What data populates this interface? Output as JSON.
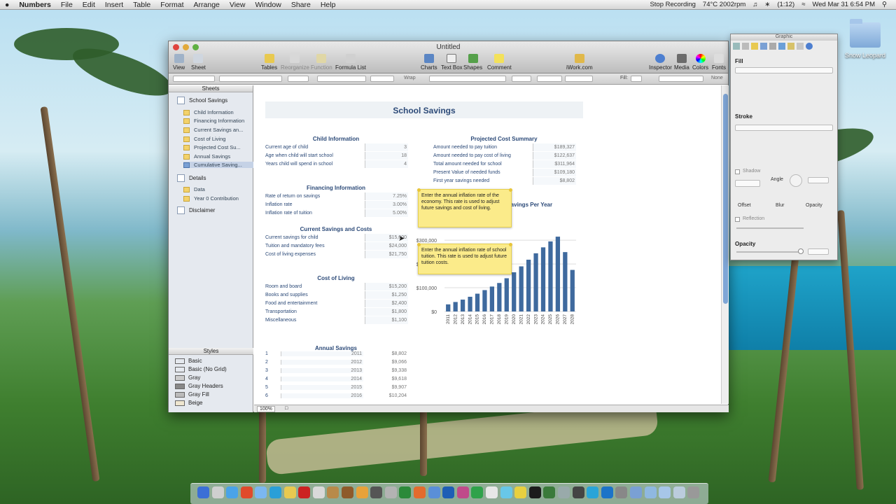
{
  "menubar": {
    "apple": "",
    "app": "Numbers",
    "items": [
      "File",
      "Edit",
      "Insert",
      "Table",
      "Format",
      "Arrange",
      "View",
      "Window",
      "Share",
      "Help"
    ],
    "status": [
      "Stop Recording",
      "74°C 2002rpm",
      "(1:12)",
      "Wed Mar 31  6:54 PM"
    ]
  },
  "desktop": {
    "drive_label": "Snow Leopard"
  },
  "window": {
    "title": "Untitled",
    "toolbar": {
      "view": "View",
      "sheet": "Sheet",
      "tables": "Tables",
      "reorganize": "Reorganize",
      "function": "Function",
      "formula_list": "Formula List",
      "charts": "Charts",
      "text_box": "Text Box",
      "shapes": "Shapes",
      "comment": "Comment",
      "iwork": "iWork.com",
      "inspector": "Inspector",
      "media": "Media",
      "colors": "Colors",
      "fonts": "Fonts"
    },
    "format_bar": {
      "wrap": "Wrap",
      "fill": "Fill:",
      "none": "None"
    },
    "zoom": "100%"
  },
  "sidebar": {
    "sheets_header": "Sheets",
    "sheet1": "School Savings",
    "tables1": [
      "Child Information",
      "Financing Information",
      "Current Savings an...",
      "Cost of Living",
      "Projected Cost Su...",
      "Annual Savings",
      "Cumulative Saving..."
    ],
    "sheet2": "Details",
    "tables2": [
      "Data",
      "Year 0 Contribution"
    ],
    "sheet3": "Disclaimer",
    "styles_header": "Styles",
    "styles": [
      "Basic",
      "Basic (No Grid)",
      "Gray",
      "Gray Headers",
      "Gray Fill",
      "Beige"
    ]
  },
  "doc": {
    "title": "School Savings",
    "child": {
      "title": "Child Information",
      "rows": [
        {
          "label": "Current age of child",
          "value": "3"
        },
        {
          "label": "Age when child will start school",
          "value": "18"
        },
        {
          "label": "Years child will spend in school",
          "value": "4"
        }
      ]
    },
    "financing": {
      "title": "Financing Information",
      "rows": [
        {
          "label": "Rate of return on savings",
          "value": "7.25%"
        },
        {
          "label": "Inflation rate",
          "value": "3.00%"
        },
        {
          "label": "Inflation rate of tuition",
          "value": "5.00%"
        }
      ]
    },
    "current": {
      "title": "Current Savings and Costs",
      "rows": [
        {
          "label": "Current savings for child",
          "value": "$15,000"
        },
        {
          "label": "Tuition and mandatory fees",
          "value": "$24,000"
        },
        {
          "label": "Cost of living expenses",
          "value": "$21,750"
        }
      ]
    },
    "living": {
      "title": "Cost of Living",
      "rows": [
        {
          "label": "Room and board",
          "value": "$15,200"
        },
        {
          "label": "Books and supplies",
          "value": "$1,250"
        },
        {
          "label": "Food and entertainment",
          "value": "$2,400"
        },
        {
          "label": "Transportation",
          "value": "$1,800"
        },
        {
          "label": "Miscellaneous",
          "value": "$1,100"
        }
      ]
    },
    "projected": {
      "title": "Projected Cost Summary",
      "rows": [
        {
          "label": "Amount needed to pay tuition",
          "value": "$189,327"
        },
        {
          "label": "Amount needed to pay cost of living",
          "value": "$122,637"
        },
        {
          "label": "Total amount needed for school",
          "value": "$311,964"
        },
        {
          "label": "Present Value of needed funds",
          "value": "$109,180"
        },
        {
          "label": "First year savings needed",
          "value": "$8,802"
        }
      ]
    },
    "annual": {
      "title": "Annual Savings",
      "rows": [
        {
          "n": "1",
          "year": "2011",
          "value": "$8,802"
        },
        {
          "n": "2",
          "year": "2012",
          "value": "$9,066"
        },
        {
          "n": "3",
          "year": "2013",
          "value": "$9,338"
        },
        {
          "n": "4",
          "year": "2014",
          "value": "$9,618"
        },
        {
          "n": "5",
          "year": "2015",
          "value": "$9,907"
        },
        {
          "n": "6",
          "year": "2016",
          "value": "$10,204"
        }
      ]
    },
    "notes": {
      "inflation": "Enter the annual inflation rate of the economy.  This rate is used to adjust future savings and cost of living.",
      "tuition": "Enter the annual inflation rate of school tuition. This rate is used to adjust future tuition costs."
    }
  },
  "chart_data": {
    "type": "bar",
    "title": "...avings Per Year",
    "categories": [
      "2011",
      "2012",
      "2013",
      "2014",
      "2015",
      "2016",
      "2017",
      "2018",
      "2019",
      "2020",
      "2021",
      "2022",
      "2023",
      "2024",
      "2025",
      "2026",
      "2027",
      "2028"
    ],
    "values": [
      30000,
      40000,
      50000,
      62000,
      75000,
      90000,
      105000,
      120000,
      140000,
      165000,
      190000,
      218000,
      245000,
      270000,
      295000,
      315000,
      250000,
      175000,
      95000
    ],
    "ytick_labels": [
      "$0",
      "$100,000",
      "$200,000",
      "$300,000"
    ],
    "ylim": [
      0,
      330000
    ],
    "bar_color": "#3f6a9e"
  },
  "inspector": {
    "title": "Graphic",
    "fill": "Fill",
    "stroke": "Stroke",
    "shadow": "Shadow",
    "angle": "Angle",
    "offset": "Offset",
    "blur": "Blur",
    "opacity_small": "Opacity",
    "reflection": "Reflection",
    "opacity": "Opacity"
  }
}
